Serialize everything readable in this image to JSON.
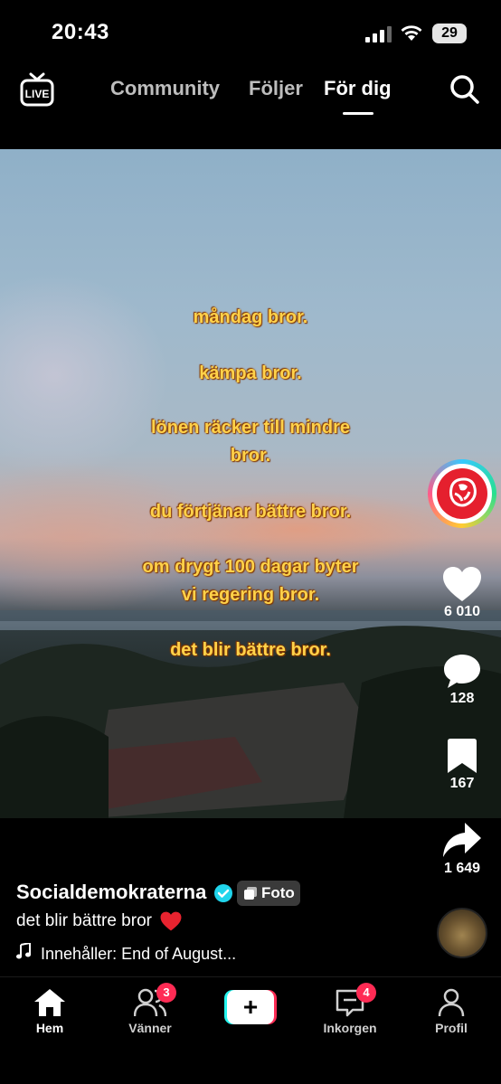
{
  "status_bar": {
    "time": "20:43",
    "battery": "29"
  },
  "top_nav": {
    "live_label": "LIVE",
    "tabs": [
      {
        "label": "Community",
        "active": false
      },
      {
        "label": "Följer",
        "active": false
      },
      {
        "label": "För dig",
        "active": true
      }
    ]
  },
  "video": {
    "overlay_lines": [
      "måndag bror.",
      "kämpa bror.",
      "lönen räcker till mindre",
      "bror.",
      "du förtjänar bättre bror.",
      "om drygt 100 dagar byter",
      "vi regering bror.",
      "det blir bättre bror."
    ],
    "overlay_color": "#ffd24a"
  },
  "actions": {
    "likes": "6 010",
    "comments": "128",
    "saves": "167",
    "shares": "1 649"
  },
  "post": {
    "username": "Socialdemokraterna",
    "verified": true,
    "badge": "Foto",
    "caption": "det blir bättre bror",
    "caption_emoji": "red-heart-icon",
    "music": "Innehåller: End of August..."
  },
  "bottom_nav": {
    "items": [
      {
        "label": "Hem",
        "icon": "home-icon",
        "active": true
      },
      {
        "label": "Vänner",
        "icon": "friends-icon",
        "badge": "3"
      },
      {
        "label": "",
        "icon": "plus-icon"
      },
      {
        "label": "Inkorgen",
        "icon": "inbox-icon",
        "badge": "4"
      },
      {
        "label": "Profil",
        "icon": "profile-icon"
      }
    ]
  },
  "colors": {
    "accent_red": "#fe2c55",
    "accent_cyan": "#24f4ee",
    "badge_red": "#ff2b54",
    "verified_blue": "#20d5ec"
  }
}
